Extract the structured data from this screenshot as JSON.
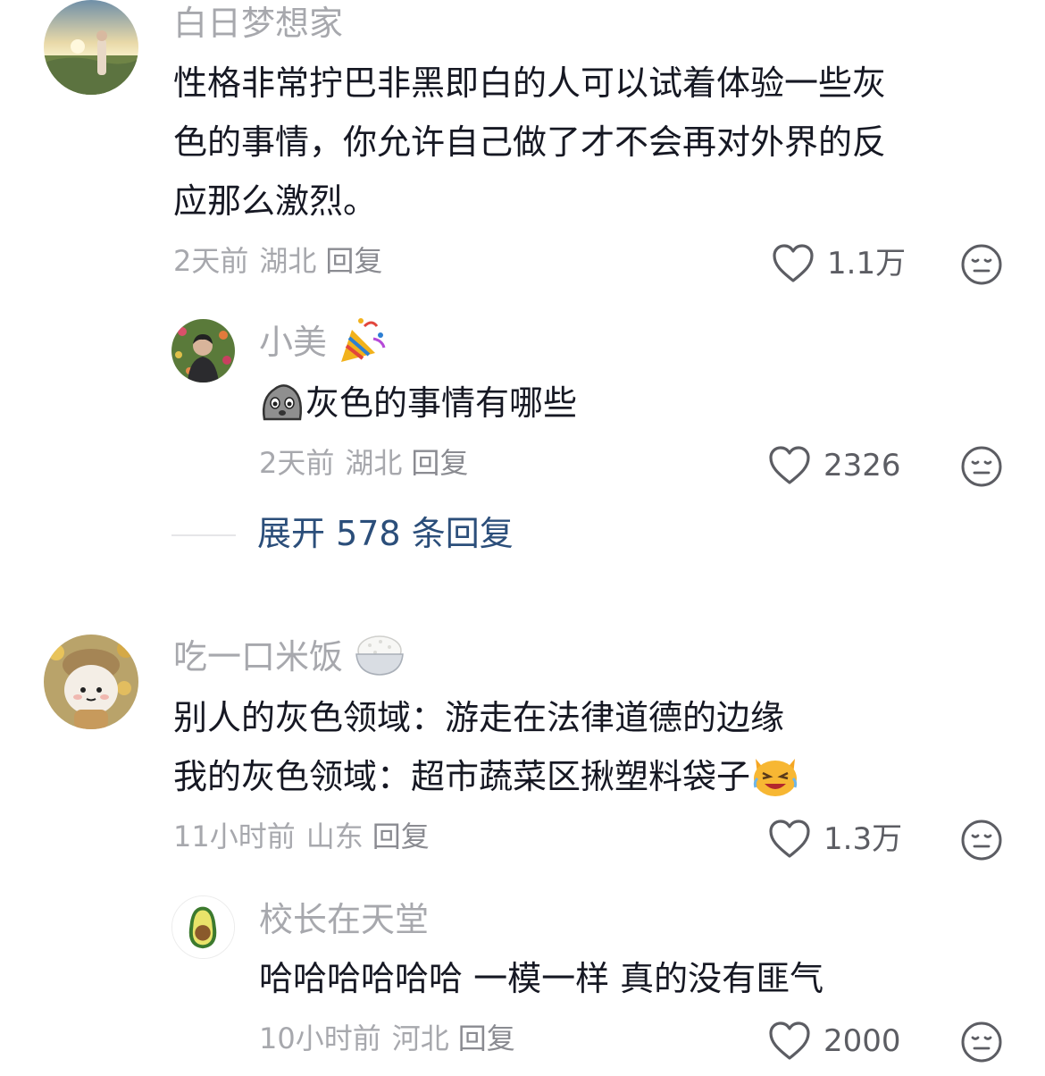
{
  "comments": [
    {
      "username": "白日梦想家",
      "text_lines": [
        "性格非常拧巴非黑即白的人可以试着体验一些灰",
        "色的事情，你允许自己做了才不会再对外界的反",
        "应那么激烈。"
      ],
      "time": "2天前",
      "location": "湖北",
      "reply_label": "回复",
      "likes": "1.1万",
      "avatar_icon": "sunset-landscape-avatar",
      "replies": [
        {
          "username": "小美",
          "username_emoji": "party-popper-icon",
          "text": "灰色的事情有哪些",
          "text_emoji": "grey-blob-sticker-icon",
          "time": "2天前",
          "location": "湖北",
          "reply_label": "回复",
          "likes": "2326",
          "avatar_icon": "person-in-garden-avatar"
        }
      ],
      "expand_label": "展开 578 条回复"
    },
    {
      "username": "吃一口米饭",
      "username_emoji": "rice-bowl-icon",
      "text_lines": [
        "别人的灰色领域：游走在法律道德的边缘",
        "我的灰色领域：超市蔬菜区揪塑料袋子"
      ],
      "text_emoji": "laughing-cat-icon",
      "time": "11小时前",
      "location": "山东",
      "reply_label": "回复",
      "likes": "1.3万",
      "avatar_icon": "plush-toy-avatar",
      "replies": [
        {
          "username": "校长在天堂",
          "text": "哈哈哈哈哈哈 一模一样 真的没有匪气",
          "time": "10小时前",
          "location": "河北",
          "reply_label": "回复",
          "likes": "2000",
          "avatar_icon": "avocado-avatar"
        }
      ]
    }
  ],
  "colors": {
    "text": "#161823",
    "secondary": "#a7a8ad",
    "link": "#2b4e7a",
    "icon": "#5c5d63"
  }
}
